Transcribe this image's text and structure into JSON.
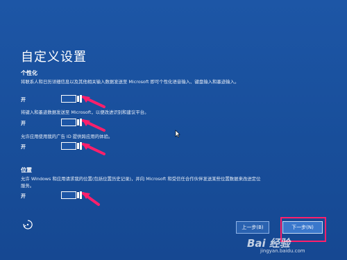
{
  "page_title": "自定义设置",
  "personalization": {
    "heading": "个性化",
    "items": [
      {
        "description": "将联系人和日历详细信息以及其他相关输入数据发送至 Microsoft 即可个性化语音输入、键盘输入和墨迹输入。",
        "state": "开"
      },
      {
        "description": "将键入和墨迹数据发送至 Microsoft，以便改进识别和建议平台。",
        "state": "开"
      },
      {
        "description": "允许应用使用我的广告 ID 提供跨应用的体验。",
        "state": "开"
      }
    ]
  },
  "location": {
    "heading": "位置",
    "items": [
      {
        "description": "允许 Windows 和应用请求我的位置(包括位置历史记录)，并向 Microsoft 和受信任合作伙伴发送某些位置数据来改进定位服务。",
        "state": "开"
      }
    ]
  },
  "buttons": {
    "back": "上一步(B)",
    "next": "下一步(N)"
  },
  "watermark": {
    "brand": "Bai 经验",
    "url": "jingyan.baidu.com"
  },
  "colors": {
    "background": "#1a4f9c",
    "annotation": "#ff1f6b"
  }
}
